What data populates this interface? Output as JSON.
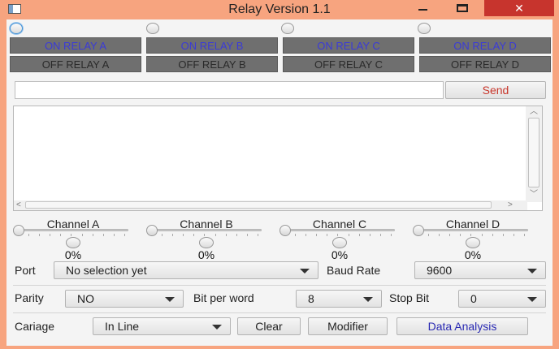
{
  "window": {
    "title": "Relay Version 1.1",
    "close_glyph": "✕"
  },
  "relays": [
    {
      "on_label": "ON RELAY A",
      "off_label": "OFF RELAY A"
    },
    {
      "on_label": "ON RELAY B",
      "off_label": "OFF RELAY B"
    },
    {
      "on_label": "ON RELAY C",
      "off_label": "OFF RELAY C"
    },
    {
      "on_label": "ON RELAY D",
      "off_label": "OFF RELAY D"
    }
  ],
  "send": {
    "input_value": "",
    "button_label": "Send"
  },
  "channels": [
    {
      "label": "Channel A",
      "percent": "0%",
      "level": 0
    },
    {
      "label": "Channel B",
      "percent": "0%",
      "level": 0
    },
    {
      "label": "Channel C",
      "percent": "0%",
      "level": 0
    },
    {
      "label": "Channel D",
      "percent": "0%",
      "level": 0
    }
  ],
  "serial": {
    "port_label": "Port",
    "port_value": "No selection yet",
    "baud_label": "Baud Rate",
    "baud_value": "9600",
    "parity_label": "Parity",
    "parity_value": "NO",
    "bits_label": "Bit per word",
    "bits_value": "8",
    "stop_label": "Stop Bit",
    "stop_value": "0",
    "carriage_label": "Cariage",
    "carriage_value": "In Line"
  },
  "actions": {
    "clear": "Clear",
    "modifier": "Modifier",
    "analysis": "Data Analysis"
  },
  "colors": {
    "frame": "#f7a47f",
    "on_text": "#3b3bd6",
    "send_text": "#c8362b",
    "close_bg": "#c7342d"
  }
}
